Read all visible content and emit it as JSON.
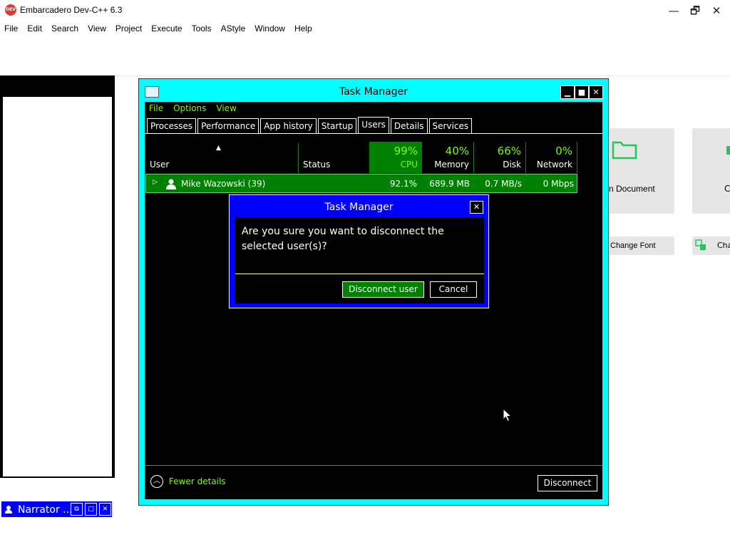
{
  "devcpp": {
    "title": "Embarcadero Dev-C++ 6.3",
    "icon_label": "DEV C++",
    "menu": [
      "File",
      "Edit",
      "Search",
      "View",
      "Project",
      "Execute",
      "Tools",
      "AStyle",
      "Window",
      "Help"
    ],
    "window_controls": {
      "minimize": "—",
      "maximize": "🗗",
      "close": "✕"
    },
    "welcome": {
      "open_document_label": "n Document",
      "other_tile_label": "C",
      "change_font_label": "Change Font",
      "cha_label": "Cha"
    }
  },
  "task_manager": {
    "title": "Task Manager",
    "menu": [
      "File",
      "Options",
      "View"
    ],
    "tabs": [
      "Processes",
      "Performance",
      "App history",
      "Startup",
      "Users",
      "Details",
      "Services"
    ],
    "active_tab": "Users",
    "columns": {
      "user": "User",
      "status": "Status",
      "cpu": {
        "pct": "99%",
        "label": "CPU"
      },
      "memory": {
        "pct": "40%",
        "label": "Memory"
      },
      "disk": {
        "pct": "66%",
        "label": "Disk"
      },
      "network": {
        "pct": "0%",
        "label": "Network"
      }
    },
    "rows": [
      {
        "user": "Mike Wazowski (39)",
        "status": "",
        "cpu": "92.1%",
        "memory": "689.9 MB",
        "disk": "0.7 MB/s",
        "network": "0 Mbps"
      }
    ],
    "footer": {
      "fewer_details": "Fewer details",
      "disconnect": "Disconnect"
    }
  },
  "dialog": {
    "title": "Task Manager",
    "message": "Are you sure you want to disconnect the selected user(s)?",
    "confirm": "Disconnect user",
    "cancel": "Cancel"
  },
  "narrator": {
    "label": "Narrator ..."
  },
  "colors": {
    "accent_cyan": "#00ffff",
    "text_green": "#7cfc00",
    "highlight_green": "#008000",
    "dialog_blue": "#0000ff"
  }
}
